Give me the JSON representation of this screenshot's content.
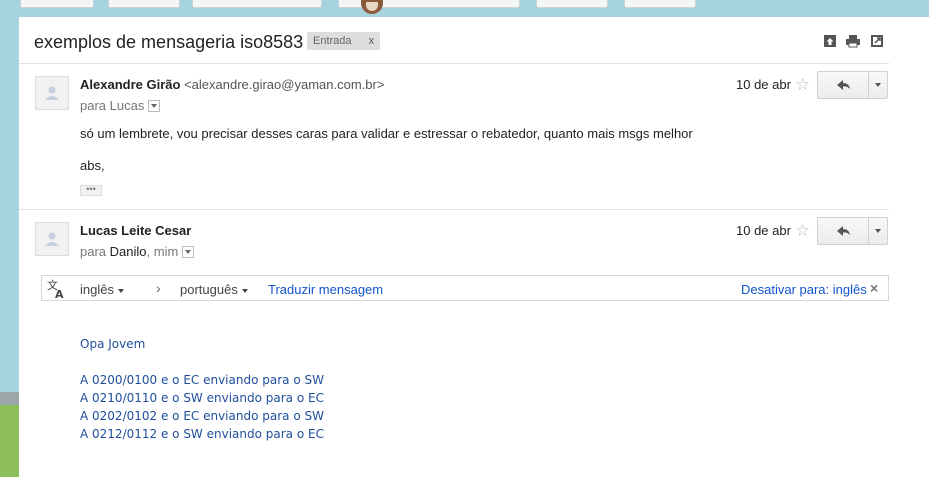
{
  "background": {
    "top_tabs": [
      "",
      "",
      "",
      "",
      "",
      ""
    ]
  },
  "thread": {
    "subject": "exemplos de mensageria iso8583",
    "label_chip": "Entrada",
    "label_remove": "x",
    "header_icons": [
      "archive-icon",
      "print-icon",
      "new-window-icon"
    ]
  },
  "messages": [
    {
      "sender_name": "Alexandre Girão",
      "sender_email": "<alexandre.girao@yaman.com.br>",
      "to_prefix": "para",
      "to_names": "Lucas",
      "date": "10 de abr",
      "body": [
        "só um lembrete, vou precisar desses caras para validar e estressar o rebatedor, quanto mais msgs melhor",
        "abs,"
      ],
      "ellipsis": "•••"
    },
    {
      "sender_name": "Lucas Leite Cesar",
      "to_prefix": "para",
      "to_names": "Danilo",
      "to_me": ", mim",
      "date": "10 de abr",
      "body": [
        "Opa Jovem",
        "A 0200/0100 e o EC enviando para o SW",
        "A 0210/0110 e o SW enviando para o EC",
        "A 0202/0102 e o EC enviando para o SW",
        "A 0212/0112 e o SW enviando para o EC"
      ]
    }
  ],
  "translate": {
    "source_lang": "inglês",
    "arrow": "›",
    "target_lang": "português",
    "translate_link": "Traduzir mensagem",
    "disable_link": "Desativar para: inglês",
    "close": "×"
  },
  "colors": {
    "link": "#1155cc",
    "quoted_text": "#1f4e9c",
    "background": "#a7d3de"
  }
}
